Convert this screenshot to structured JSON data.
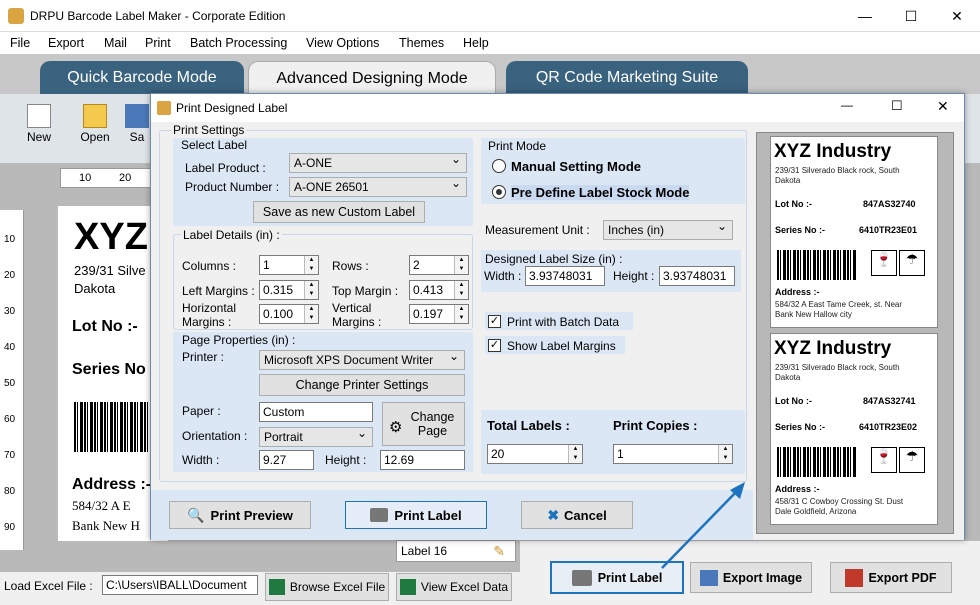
{
  "app": {
    "title": "DRPU Barcode Label Maker - Corporate Edition"
  },
  "menu": [
    "File",
    "Export",
    "Mail",
    "Print",
    "Batch Processing",
    "View Options",
    "Themes",
    "Help"
  ],
  "tabs": [
    "Quick Barcode Mode",
    "Advanced Designing Mode",
    "QR Code Marketing Suite"
  ],
  "toolbar": {
    "new": "New",
    "open": "Open",
    "save": "Sa"
  },
  "ruler": {
    "h": [
      "10",
      "20"
    ],
    "v": [
      "10",
      "20",
      "30",
      "40",
      "50",
      "60",
      "70",
      "80",
      "90"
    ]
  },
  "bg_label": {
    "company": "XYZ",
    "addr1": "239/31 Silve",
    "addr2": "Dakota",
    "lot": "Lot No :-",
    "series": "Series No",
    "address_h": "Address :-",
    "address1": "584/32 A E",
    "address2": "Bank New H",
    "tab_label": "Label 16"
  },
  "bottom": {
    "load_excel": "Load Excel File :",
    "excel_path": "C:\\Users\\IBALL\\Document",
    "browse": "Browse Excel File",
    "view": "View Excel Data",
    "print": "Print Label",
    "export_image": "Export Image",
    "export_pdf": "Export PDF"
  },
  "dialog": {
    "title": "Print Designed Label",
    "print_settings": "Print Settings",
    "select_label": "Select Label",
    "label_product_lbl": "Label Product :",
    "label_product": "A-ONE",
    "product_number_lbl": "Product Number :",
    "product_number": "A-ONE 26501",
    "save_custom": "Save as new Custom Label",
    "label_details": "Label Details (in) :",
    "columns_lbl": "Columns :",
    "columns": "1",
    "rows_lbl": "Rows :",
    "rows": "2",
    "left_m_lbl": "Left Margins :",
    "left_m": "0.315",
    "top_m_lbl": "Top Margin :",
    "top_m": "0.413",
    "horiz_lbl1": "Horizontal",
    "horiz_lbl2": "Margins :",
    "horiz": "0.100",
    "vert_lbl1": "Vertical",
    "vert_lbl2": "Margins :",
    "vert": "0.197",
    "page_props": "Page Properties (in) :",
    "printer_lbl": "Printer :",
    "printer": "Microsoft XPS Document Writer",
    "change_printer": "Change Printer Settings",
    "paper_lbl": "Paper :",
    "paper": "Custom",
    "change_page1": "Change",
    "change_page2": "Page",
    "orient_lbl": "Orientation :",
    "orient": "Portrait",
    "width_lbl": "Width :",
    "width": "9.27",
    "height_lbl": "Height :",
    "height": "12.69",
    "print_mode": "Print Mode",
    "manual": "Manual Setting Mode",
    "predefine": "Pre Define Label Stock Mode",
    "meas_lbl": "Measurement Unit :",
    "meas": "Inches (in)",
    "designed_size": "Designed Label Size (in) :",
    "dw_lbl": "Width :",
    "dw": "3.93748031",
    "dh_lbl": "Height :",
    "dh": "3.93748031",
    "batch": "Print with Batch Data",
    "show_margins": "Show Label Margins",
    "total_lbl": "Total Labels :",
    "total": "20",
    "copies_lbl": "Print Copies :",
    "copies": "1",
    "preview_btn": "Print Preview",
    "print_btn": "Print Label",
    "cancel_btn": "Cancel"
  },
  "preview": [
    {
      "company": "XYZ Industry",
      "addr1": "239/31 Silverado Black rock, South",
      "addr2": "Dakota",
      "lot_lbl": "Lot No :-",
      "lot": "847AS32740",
      "series_lbl": "Series No :-",
      "series": "6410TR23E01",
      "address_h": "Address :-",
      "address1": "584/32 A East Tame Creek, st. Near",
      "address2": "Bank New Hallow city"
    },
    {
      "company": "XYZ Industry",
      "addr1": "239/31 Silverado Black rock, South",
      "addr2": "Dakota",
      "lot_lbl": "Lot No :-",
      "lot": "847AS32741",
      "series_lbl": "Series No :-",
      "series": "6410TR23E02",
      "address_h": "Address :-",
      "address1": "458/31 C Cowboy Crossing  St. Dust",
      "address2": "Dale Goldfield, Arizona"
    }
  ],
  "colors": {
    "tab_bg": "#39627f",
    "accent": "#1e73be"
  }
}
